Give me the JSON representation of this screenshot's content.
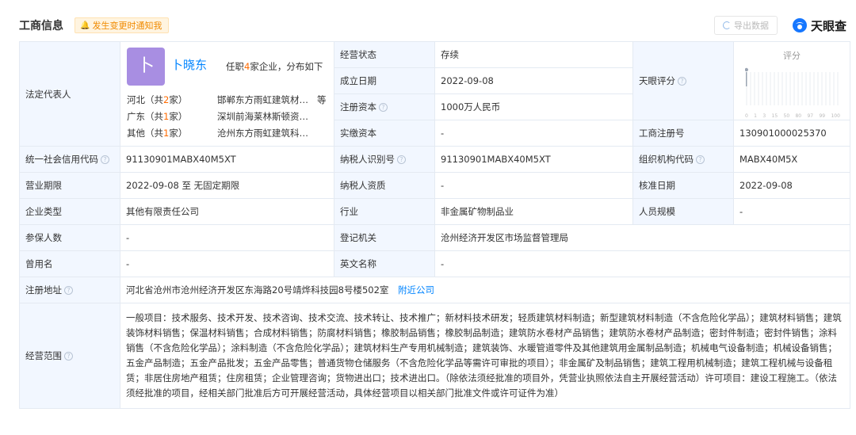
{
  "header": {
    "title": "工商信息",
    "notify_label": "发生变更时通知我",
    "export_label": "导出数据",
    "logo_text": "天眼查"
  },
  "legal_rep": {
    "label": "法定代表人",
    "avatar_char": "卜",
    "name": "卜晓东",
    "job_prefix": "任职",
    "job_count": "4",
    "job_suffix": "家企业，分布如下",
    "distribution": [
      {
        "region": "河北（共",
        "count": "2",
        "unit": "家）",
        "company": "邯郸东方雨虹建筑材料有限公司",
        "etc": "等"
      },
      {
        "region": "广东（共",
        "count": "1",
        "unit": "家）",
        "company": "深圳前海莱林斯顿资产管理有限公司",
        "etc": ""
      },
      {
        "region": "其他（共",
        "count": "1",
        "unit": "家）",
        "company": "沧州东方雨虹建筑科技有限公司",
        "etc": ""
      }
    ]
  },
  "fields": {
    "status_label": "经营状态",
    "status_value": "存续",
    "found_label": "成立日期",
    "found_value": "2022-09-08",
    "capital_label": "注册资本",
    "capital_value": "1000万人民币",
    "paid_label": "实缴资本",
    "paid_value": "-",
    "score_label": "天眼评分",
    "score_title": "评分",
    "regno_label": "工商注册号",
    "regno_value": "130901000025370",
    "credit_label": "统一社会信用代码",
    "credit_value": "91130901MABX40M5XT",
    "taxid_label": "纳税人识别号",
    "taxid_value": "91130901MABX40M5XT",
    "org_label": "组织机构代码",
    "org_value": "MABX40M5X",
    "term_label": "营业期限",
    "term_value": "2022-09-08 至 无固定期限",
    "taxq_label": "纳税人资质",
    "taxq_value": "-",
    "approve_label": "核准日期",
    "approve_value": "2022-09-08",
    "type_label": "企业类型",
    "type_value": "其他有限责任公司",
    "industry_label": "行业",
    "industry_value": "非金属矿物制品业",
    "staff_label": "人员规模",
    "staff_value": "-",
    "insured_label": "参保人数",
    "insured_value": "-",
    "authority_label": "登记机关",
    "authority_value": "沧州经济开发区市场监督管理局",
    "former_label": "曾用名",
    "former_value": "-",
    "en_label": "英文名称",
    "en_value": "-",
    "addr_label": "注册地址",
    "addr_value": "河北省沧州市沧州经济开发区东海路20号靖烨科技园8号楼502室",
    "nearby_label": "附近公司",
    "scope_label": "经营范围",
    "scope_value": "一般项目：技术服务、技术开发、技术咨询、技术交流、技术转让、技术推广；新材料技术研发；轻质建筑材料制造；新型建筑材料制造（不含危险化学品）；建筑材料销售；建筑装饰材料销售；保温材料销售；合成材料销售；防腐材料销售；橡胶制品销售；橡胶制品制造；建筑防水卷材产品销售；建筑防水卷材产品制造；密封件制造；密封件销售；涂料销售（不含危险化学品）；涂料制造（不含危险化学品）；建筑材料生产专用机械制造；建筑装饰、水暖管道零件及其他建筑用金属制品制造；机械电气设备制造；机械设备销售；五金产品制造；五金产品批发；五金产品零售；普通货物仓储服务（不含危险化学品等需许可审批的项目）；非金属矿及制品销售；建筑工程用机械制造；建筑工程机械与设备租赁；非居住房地产租赁；住房租赁；企业管理咨询；货物进出口；技术进出口。（除依法须经批准的项目外，凭营业执照依法自主开展经营活动）许可项目：建设工程施工。（依法须经批准的项目，经相关部门批准后方可开展经营活动，具体经营项目以相关部门批准文件或许可证件为准）"
  },
  "score_chart": {
    "ticks": [
      "0",
      "1",
      "3",
      "15",
      "50",
      "80",
      "97",
      "99",
      "100"
    ],
    "bar_count": 24,
    "marker_fraction": 0.0
  },
  "colors": {
    "accent": "#0084ff",
    "label_bg": "#f2f7ff",
    "orange": "#ff6a00",
    "avatar": "#a88ee2"
  }
}
